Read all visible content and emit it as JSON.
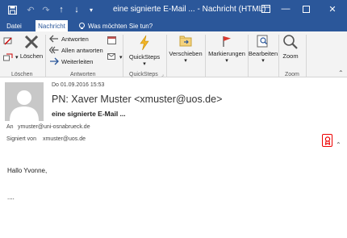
{
  "titlebar": {
    "title": "eine signierte E-Mail ... - Nachricht (HTML)"
  },
  "tabs": [
    {
      "label": "Datei"
    },
    {
      "label": "Nachricht"
    }
  ],
  "tellme": {
    "label": "Was möchten Sie tun?"
  },
  "ribbon": {
    "delete_group": {
      "delete_label": "Löschen",
      "group_label": "Löschen"
    },
    "respond_group": {
      "reply": "Antworten",
      "reply_all": "Allen antworten",
      "forward": "Weiterleiten",
      "group_label": "Antworten"
    },
    "quicksteps_group": {
      "button_label": "QuickSteps",
      "group_label": "QuickSteps"
    },
    "move": {
      "label": "Verschieben"
    },
    "tags": {
      "label": "Markierungen"
    },
    "editing": {
      "label": "Bearbeiten"
    },
    "zoom_group": {
      "button_label": "Zoom",
      "group_label": "Zoom"
    }
  },
  "message": {
    "date": "Do 01.09.2016 15:53",
    "from": "PN: Xaver Muster <xmuster@uos.de>",
    "subject": "eine signierte E-Mail ...",
    "to_label": "An",
    "to_value": "ymuster@uni-osnabrueck.de",
    "signed_label": "Signiert von",
    "signed_value": "xmuster@uos.de"
  },
  "body": {
    "greeting": "Hallo Yvonne,",
    "ellipsis": "...."
  }
}
